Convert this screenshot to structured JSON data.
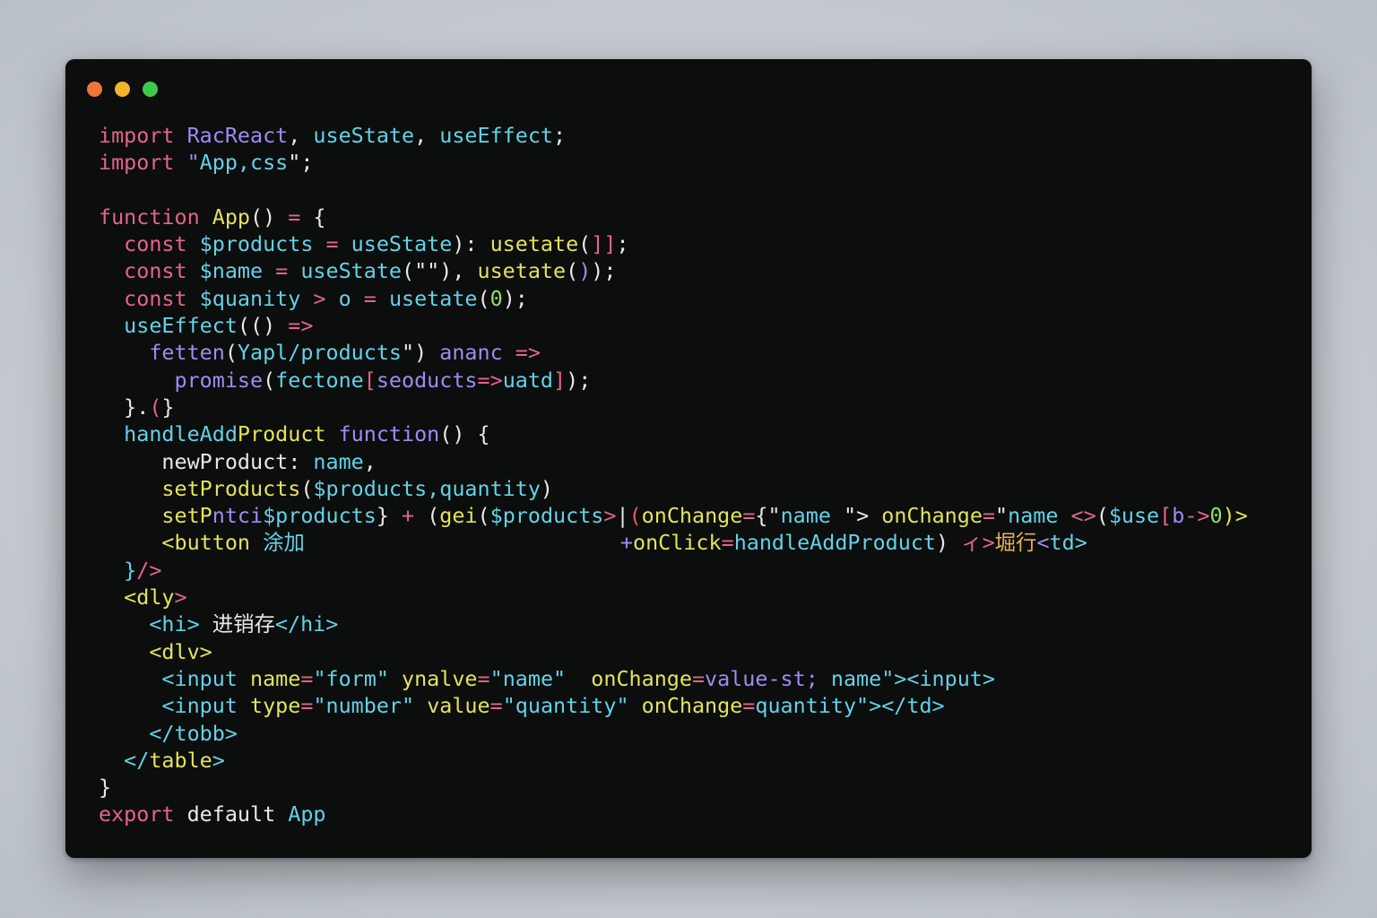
{
  "window": {
    "traffic_lights": [
      {
        "name": "close",
        "color": "#f0743a"
      },
      {
        "name": "minimize",
        "color": "#f2b52a"
      },
      {
        "name": "maximize",
        "color": "#3ec94b"
      }
    ]
  },
  "code": {
    "lines": [
      {
        "tokens": [
          {
            "t": "import ",
            "c": "k"
          },
          {
            "t": "RacReact",
            "c": "p"
          },
          {
            "t": ", ",
            "c": "w"
          },
          {
            "t": "useState",
            "c": "c"
          },
          {
            "t": ", ",
            "c": "w"
          },
          {
            "t": "useEffect",
            "c": "c"
          },
          {
            "t": ";",
            "c": "w"
          }
        ]
      },
      {
        "tokens": [
          {
            "t": "import ",
            "c": "k"
          },
          {
            "t": "\"",
            "c": "p"
          },
          {
            "t": "App,css",
            "c": "c"
          },
          {
            "t": "\";",
            "c": "w"
          }
        ]
      },
      {
        "tokens": []
      },
      {
        "tokens": [
          {
            "t": "function ",
            "c": "k"
          },
          {
            "t": "App",
            "c": "y"
          },
          {
            "t": "() ",
            "c": "w"
          },
          {
            "t": "= ",
            "c": "k"
          },
          {
            "t": "{",
            "c": "w"
          }
        ]
      },
      {
        "tokens": [
          {
            "t": "  const ",
            "c": "k"
          },
          {
            "t": "$products ",
            "c": "c"
          },
          {
            "t": "= ",
            "c": "k"
          },
          {
            "t": "useState",
            "c": "c"
          },
          {
            "t": "): ",
            "c": "w"
          },
          {
            "t": "usetate",
            "c": "y"
          },
          {
            "t": "(",
            "c": "w"
          },
          {
            "t": "]]",
            "c": "k"
          },
          {
            "t": ";",
            "c": "w"
          }
        ]
      },
      {
        "tokens": [
          {
            "t": "  const ",
            "c": "k"
          },
          {
            "t": "$name ",
            "c": "c"
          },
          {
            "t": "= ",
            "c": "k"
          },
          {
            "t": "useState",
            "c": "c"
          },
          {
            "t": "(\"\"), ",
            "c": "w"
          },
          {
            "t": "usetate",
            "c": "y"
          },
          {
            "t": "(",
            "c": "w"
          },
          {
            "t": ")",
            "c": "p"
          },
          {
            "t": ");",
            "c": "w"
          }
        ]
      },
      {
        "tokens": [
          {
            "t": "  const ",
            "c": "k"
          },
          {
            "t": "$quanity",
            "c": "c"
          },
          {
            "t": " > ",
            "c": "k"
          },
          {
            "t": "o ",
            "c": "c"
          },
          {
            "t": "= ",
            "c": "k"
          },
          {
            "t": "usetate",
            "c": "c"
          },
          {
            "t": "(",
            "c": "w"
          },
          {
            "t": "0",
            "c": "g"
          },
          {
            "t": ");",
            "c": "w"
          }
        ]
      },
      {
        "tokens": [
          {
            "t": "  useEffect",
            "c": "c"
          },
          {
            "t": "(() ",
            "c": "w"
          },
          {
            "t": "=>",
            "c": "k"
          }
        ]
      },
      {
        "tokens": [
          {
            "t": "    fetten",
            "c": "p"
          },
          {
            "t": "(",
            "c": "w"
          },
          {
            "t": "Yapl/products",
            "c": "c"
          },
          {
            "t": "\") ",
            "c": "w"
          },
          {
            "t": "ananc ",
            "c": "p"
          },
          {
            "t": "=>",
            "c": "k"
          }
        ]
      },
      {
        "tokens": [
          {
            "t": "      promise",
            "c": "p"
          },
          {
            "t": "(",
            "c": "w"
          },
          {
            "t": "fectone",
            "c": "c"
          },
          {
            "t": "[",
            "c": "k"
          },
          {
            "t": "seoducts",
            "c": "p"
          },
          {
            "t": "=>",
            "c": "k"
          },
          {
            "t": "uatd",
            "c": "c"
          },
          {
            "t": "]",
            "c": "k"
          },
          {
            "t": ");",
            "c": "w"
          }
        ]
      },
      {
        "tokens": [
          {
            "t": "  }.",
            "c": "w"
          },
          {
            "t": "(",
            "c": "k"
          },
          {
            "t": "}",
            "c": "w"
          }
        ]
      },
      {
        "tokens": [
          {
            "t": "  handleAdd",
            "c": "c"
          },
          {
            "t": "Product ",
            "c": "y"
          },
          {
            "t": "function",
            "c": "p"
          },
          {
            "t": "() {",
            "c": "w"
          }
        ]
      },
      {
        "tokens": [
          {
            "t": "     newProduct: ",
            "c": "w"
          },
          {
            "t": "name",
            "c": "c"
          },
          {
            "t": ",",
            "c": "w"
          }
        ]
      },
      {
        "tokens": [
          {
            "t": "     setProducts",
            "c": "y"
          },
          {
            "t": "(",
            "c": "w"
          },
          {
            "t": "$products,quantity",
            "c": "c"
          },
          {
            "t": ")",
            "c": "w"
          }
        ]
      },
      {
        "tokens": [
          {
            "t": "     setP",
            "c": "y"
          },
          {
            "t": "ntci",
            "c": "p"
          },
          {
            "t": "$products",
            "c": "c"
          },
          {
            "t": "} ",
            "c": "w"
          },
          {
            "t": "+ ",
            "c": "k"
          },
          {
            "t": "(",
            "c": "w"
          },
          {
            "t": "gei",
            "c": "y"
          },
          {
            "t": "(",
            "c": "w"
          },
          {
            "t": "$products",
            "c": "c"
          },
          {
            "t": ">",
            "c": "k"
          },
          {
            "t": "|",
            "c": "w"
          },
          {
            "t": "(",
            "c": "r"
          },
          {
            "t": "onChange",
            "c": "y"
          },
          {
            "t": "=",
            "c": "k"
          },
          {
            "t": "{\"",
            "c": "w"
          },
          {
            "t": "name ",
            "c": "c"
          },
          {
            "t": "\"> ",
            "c": "w"
          },
          {
            "t": "onChange",
            "c": "y"
          },
          {
            "t": "=",
            "c": "k"
          },
          {
            "t": "\"",
            "c": "w"
          },
          {
            "t": "name ",
            "c": "c"
          },
          {
            "t": "<>",
            "c": "k"
          },
          {
            "t": "(",
            "c": "w"
          },
          {
            "t": "$use",
            "c": "c"
          },
          {
            "t": "[",
            "c": "k"
          },
          {
            "t": "b",
            "c": "p"
          },
          {
            "t": "->",
            "c": "k"
          },
          {
            "t": "0",
            "c": "g"
          },
          {
            "t": ")>",
            "c": "y"
          }
        ]
      },
      {
        "tokens": [
          {
            "t": "     <button ",
            "c": "y"
          },
          {
            "t": "涂加",
            "c": "c"
          },
          {
            "t": "                         ",
            "c": "w"
          },
          {
            "t": "+",
            "c": "p"
          },
          {
            "t": "onClick",
            "c": "y"
          },
          {
            "t": "=",
            "c": "k"
          },
          {
            "t": "handleAddProduct",
            "c": "c"
          },
          {
            "t": ") ",
            "c": "w"
          },
          {
            "t": "ィ>",
            "c": "k"
          },
          {
            "t": "堀行",
            "c": "o"
          },
          {
            "t": "<",
            "c": "p"
          },
          {
            "t": "td>",
            "c": "c"
          }
        ]
      },
      {
        "tokens": [
          {
            "t": "  }",
            "c": "c"
          },
          {
            "t": "/>",
            "c": "k"
          }
        ]
      },
      {
        "tokens": [
          {
            "t": "  <dly",
            "c": "y"
          },
          {
            "t": ">",
            "c": "k"
          }
        ]
      },
      {
        "tokens": [
          {
            "t": "    <hi> ",
            "c": "c"
          },
          {
            "t": "进销存",
            "c": "w"
          },
          {
            "t": "</hi>",
            "c": "c"
          }
        ]
      },
      {
        "tokens": [
          {
            "t": "    <dlv>",
            "c": "y"
          }
        ]
      },
      {
        "tokens": [
          {
            "t": "     <input ",
            "c": "c"
          },
          {
            "t": "name",
            "c": "y"
          },
          {
            "t": "=",
            "c": "k"
          },
          {
            "t": "\"form\" ",
            "c": "c"
          },
          {
            "t": "ynalve",
            "c": "y"
          },
          {
            "t": "=",
            "c": "k"
          },
          {
            "t": "\"name\"  ",
            "c": "c"
          },
          {
            "t": "onChange",
            "c": "y"
          },
          {
            "t": "=",
            "c": "k"
          },
          {
            "t": "value-st; ",
            "c": "p"
          },
          {
            "t": "name\"><input>",
            "c": "c"
          }
        ]
      },
      {
        "tokens": [
          {
            "t": "     <input ",
            "c": "c"
          },
          {
            "t": "type",
            "c": "y"
          },
          {
            "t": "=",
            "c": "k"
          },
          {
            "t": "\"number\" ",
            "c": "c"
          },
          {
            "t": "value",
            "c": "y"
          },
          {
            "t": "=",
            "c": "k"
          },
          {
            "t": "\"quantity\" ",
            "c": "c"
          },
          {
            "t": "onChange",
            "c": "y"
          },
          {
            "t": "=",
            "c": "k"
          },
          {
            "t": "quantity\"></td>",
            "c": "c"
          }
        ]
      },
      {
        "tokens": [
          {
            "t": "    </tobb>",
            "c": "c"
          }
        ]
      },
      {
        "tokens": [
          {
            "t": "  </",
            "c": "c"
          },
          {
            "t": "table",
            "c": "y"
          },
          {
            "t": ">",
            "c": "c"
          }
        ]
      },
      {
        "tokens": [
          {
            "t": "}",
            "c": "w"
          }
        ]
      },
      {
        "tokens": [
          {
            "t": "export ",
            "c": "k"
          },
          {
            "t": "default ",
            "c": "w"
          },
          {
            "t": "App",
            "c": "c"
          }
        ]
      }
    ]
  }
}
